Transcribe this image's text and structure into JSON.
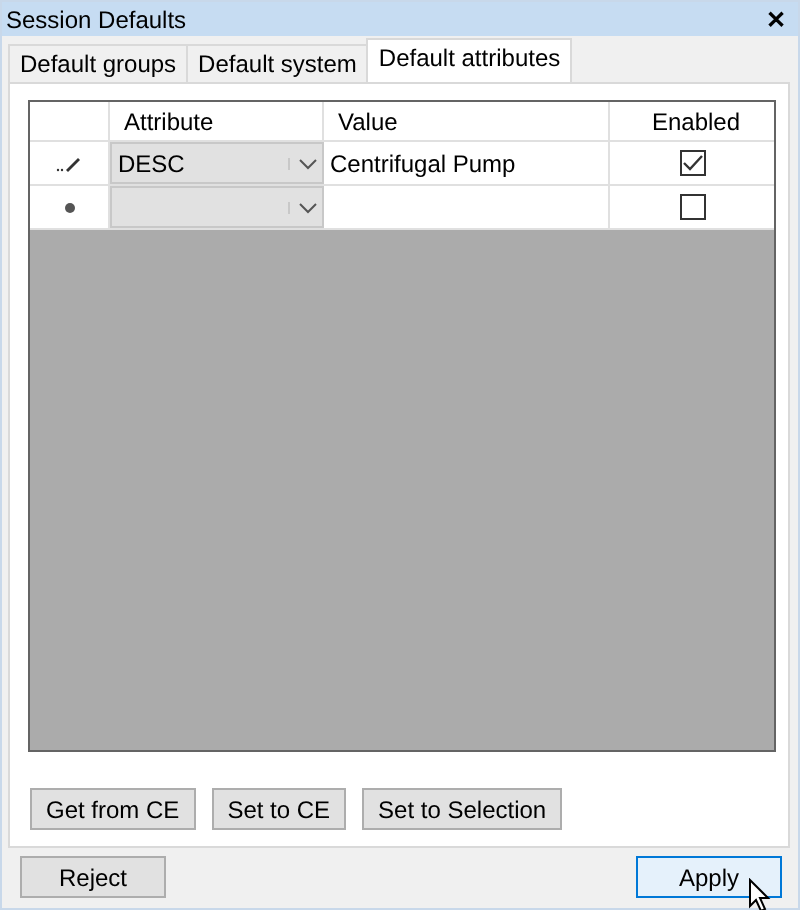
{
  "window": {
    "title": "Session Defaults",
    "close": "✕"
  },
  "tabs": [
    {
      "label": "Default groups",
      "selected": false
    },
    {
      "label": "Default system",
      "selected": false
    },
    {
      "label": "Default attributes",
      "selected": true
    }
  ],
  "grid": {
    "columns": [
      "Attribute",
      "Value",
      "Enabled"
    ],
    "rows": [
      {
        "kind": "edit",
        "attribute": "DESC",
        "value": "Centrifugal Pump",
        "enabled": true
      },
      {
        "kind": "new",
        "attribute": "",
        "value": "",
        "enabled": false
      }
    ]
  },
  "panel_buttons": [
    "Get from CE",
    "Set to CE",
    "Set to Selection"
  ],
  "footer_buttons": [
    {
      "label": "Reject",
      "focused": false
    },
    {
      "label": "Apply",
      "focused": true
    }
  ]
}
